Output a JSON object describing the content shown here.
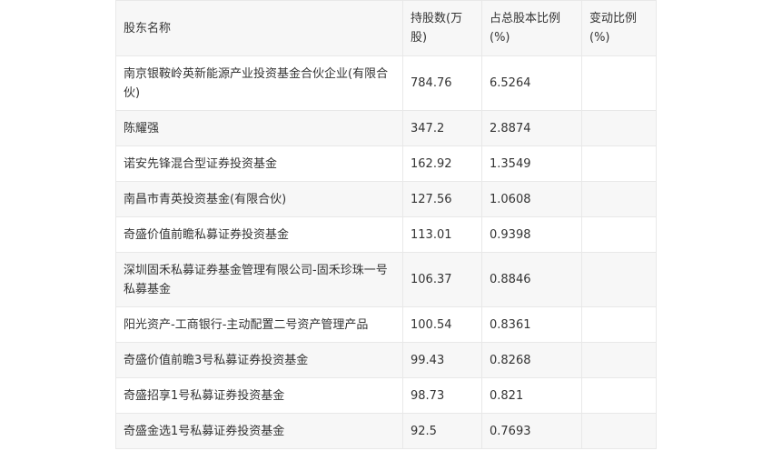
{
  "table": {
    "headers": {
      "name": "股东名称",
      "shares": "持股数(万股)",
      "ratio": "占总股本比例(%)",
      "change": "变动比例(%)"
    },
    "rows": [
      {
        "name": "南京银鞍岭英新能源产业投资基金合伙企业(有限合伙)",
        "shares": "784.76",
        "ratio": "6.5264",
        "change": ""
      },
      {
        "name": "陈耀强",
        "shares": "347.2",
        "ratio": "2.8874",
        "change": ""
      },
      {
        "name": "诺安先锋混合型证券投资基金",
        "shares": "162.92",
        "ratio": "1.3549",
        "change": ""
      },
      {
        "name": "南昌市青英投资基金(有限合伙)",
        "shares": "127.56",
        "ratio": "1.0608",
        "change": ""
      },
      {
        "name": "奇盛价值前瞻私募证券投资基金",
        "shares": "113.01",
        "ratio": "0.9398",
        "change": ""
      },
      {
        "name": "深圳固禾私募证券基金管理有限公司-固禾珍珠一号私募基金",
        "shares": "106.37",
        "ratio": "0.8846",
        "change": ""
      },
      {
        "name": "阳光资产-工商银行-主动配置二号资产管理产品",
        "shares": "100.54",
        "ratio": "0.8361",
        "change": ""
      },
      {
        "name": "奇盛价值前瞻3号私募证券投资基金",
        "shares": "99.43",
        "ratio": "0.8268",
        "change": ""
      },
      {
        "name": "奇盛招享1号私募证券投资基金",
        "shares": "98.73",
        "ratio": "0.821",
        "change": ""
      },
      {
        "name": "奇盛金选1号私募证券投资基金",
        "shares": "92.5",
        "ratio": "0.7693",
        "change": ""
      }
    ]
  }
}
